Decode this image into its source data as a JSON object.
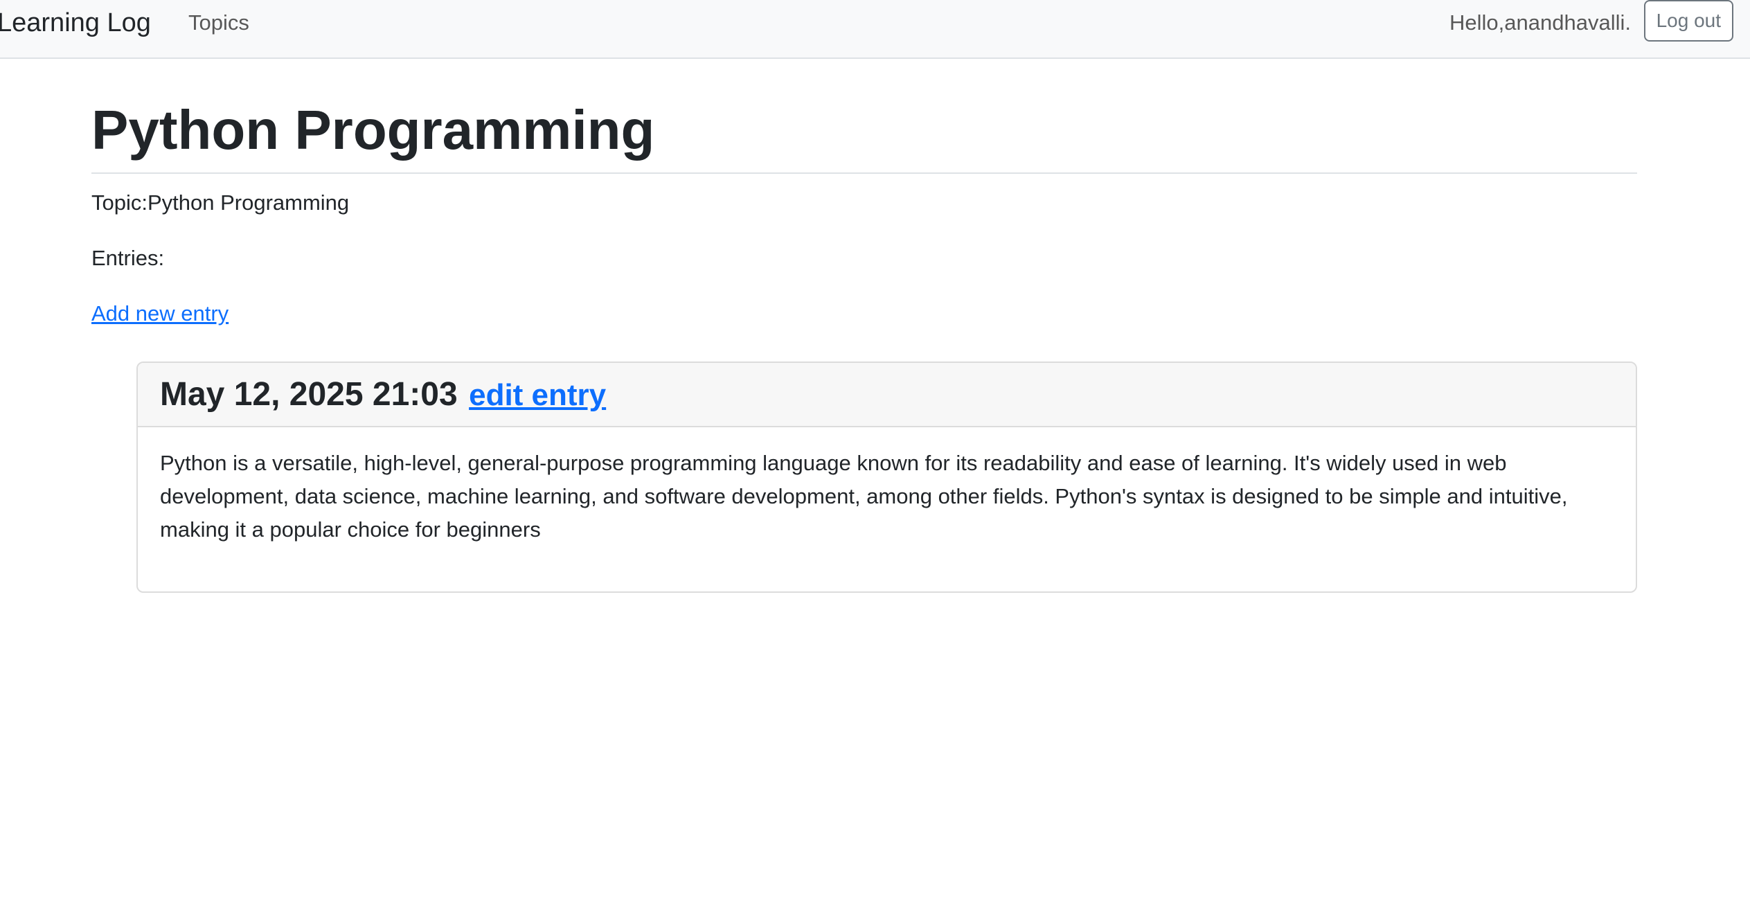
{
  "navbar": {
    "brand": "Learning Log",
    "links": [
      {
        "label": "Topics"
      }
    ],
    "greeting": "Hello,anandhavalli.",
    "logout_label": "Log out"
  },
  "main": {
    "title": "Python Programming",
    "topic_line": "Topic:Python Programming",
    "entries_label": "Entries:",
    "add_entry_label": "Add new entry"
  },
  "entries": [
    {
      "date": "May 12, 2025 21:03",
      "edit_label": "edit entry",
      "text": "Python is a versatile, high-level, general-purpose programming language known for its readability and ease of learning. It's widely used in web development, data science, machine learning, and software development, among other fields. Python's syntax is designed to be simple and intuitive, making it a popular choice for beginners"
    }
  ]
}
